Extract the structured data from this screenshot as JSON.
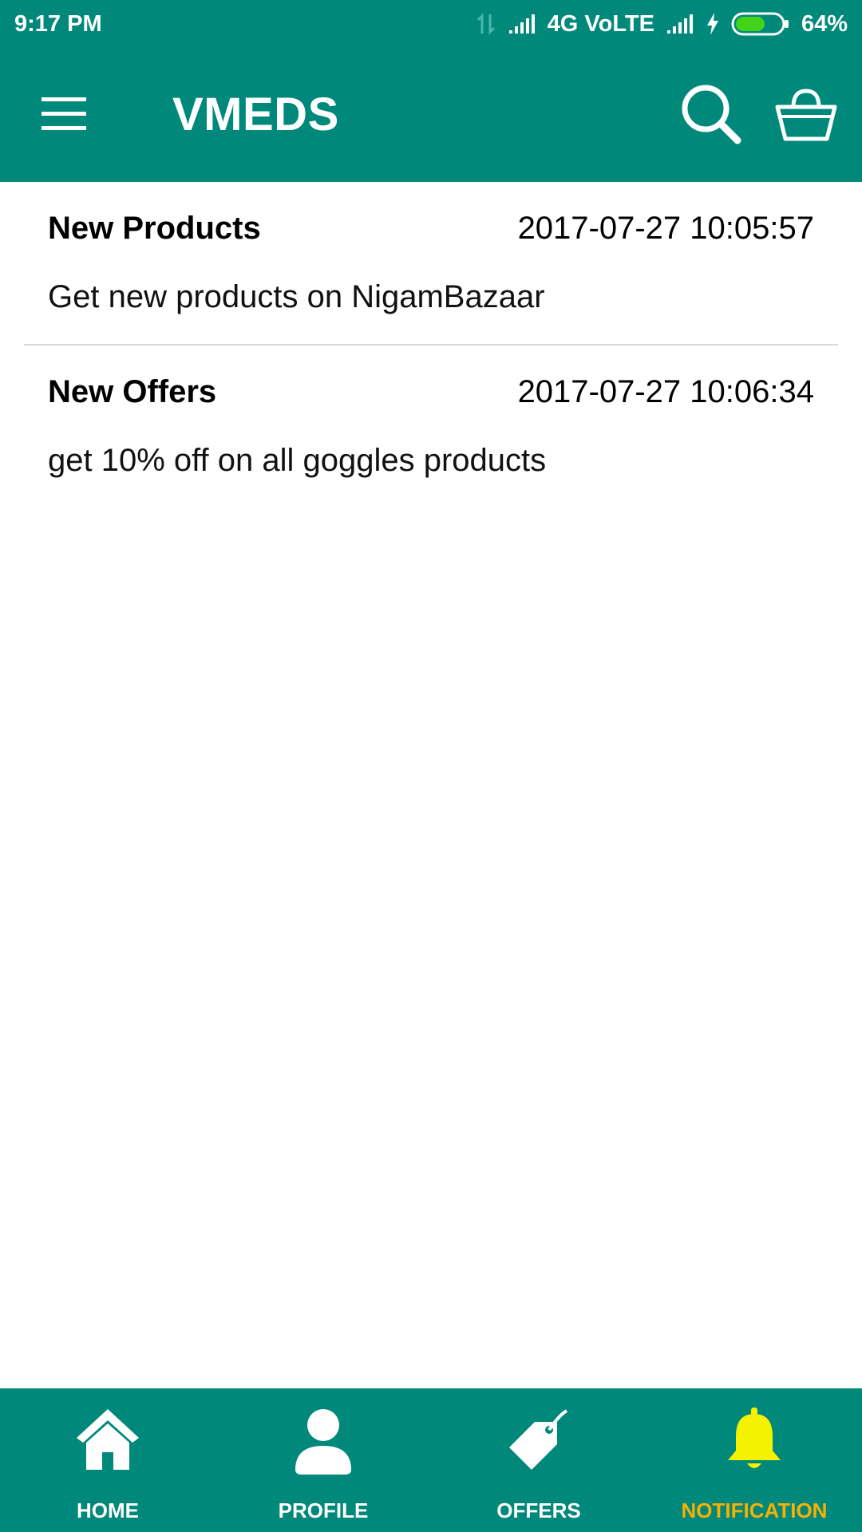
{
  "status_bar": {
    "time": "9:17 PM",
    "network": "4G VoLTE",
    "battery": "64%",
    "battery_level": 0.64,
    "battery_color": "#43d41a"
  },
  "app_bar": {
    "title": "VMEDS",
    "menu_icon": "hamburger-menu-icon",
    "search_icon": "search-icon",
    "cart_icon": "shopping-basket-icon"
  },
  "notifications": [
    {
      "title": "New Products",
      "time": "2017-07-27 10:05:57",
      "message": "Get new products on NigamBazaar"
    },
    {
      "title": "New Offers",
      "time": "2017-07-27 10:06:34",
      "message": "get 10% off on all goggles products"
    }
  ],
  "bottom_nav": {
    "items": [
      {
        "label": "HOME",
        "icon": "home-icon"
      },
      {
        "label": "PROFILE",
        "icon": "profile-icon"
      },
      {
        "label": "OFFERS",
        "icon": "tag-icon"
      },
      {
        "label": "NOTIFICATION",
        "icon": "bell-icon",
        "active": true
      }
    ],
    "active_color": "#f9b000",
    "active_icon_color": "#f5f200"
  },
  "colors": {
    "primary": "#00897b",
    "background": "#ffffff"
  }
}
